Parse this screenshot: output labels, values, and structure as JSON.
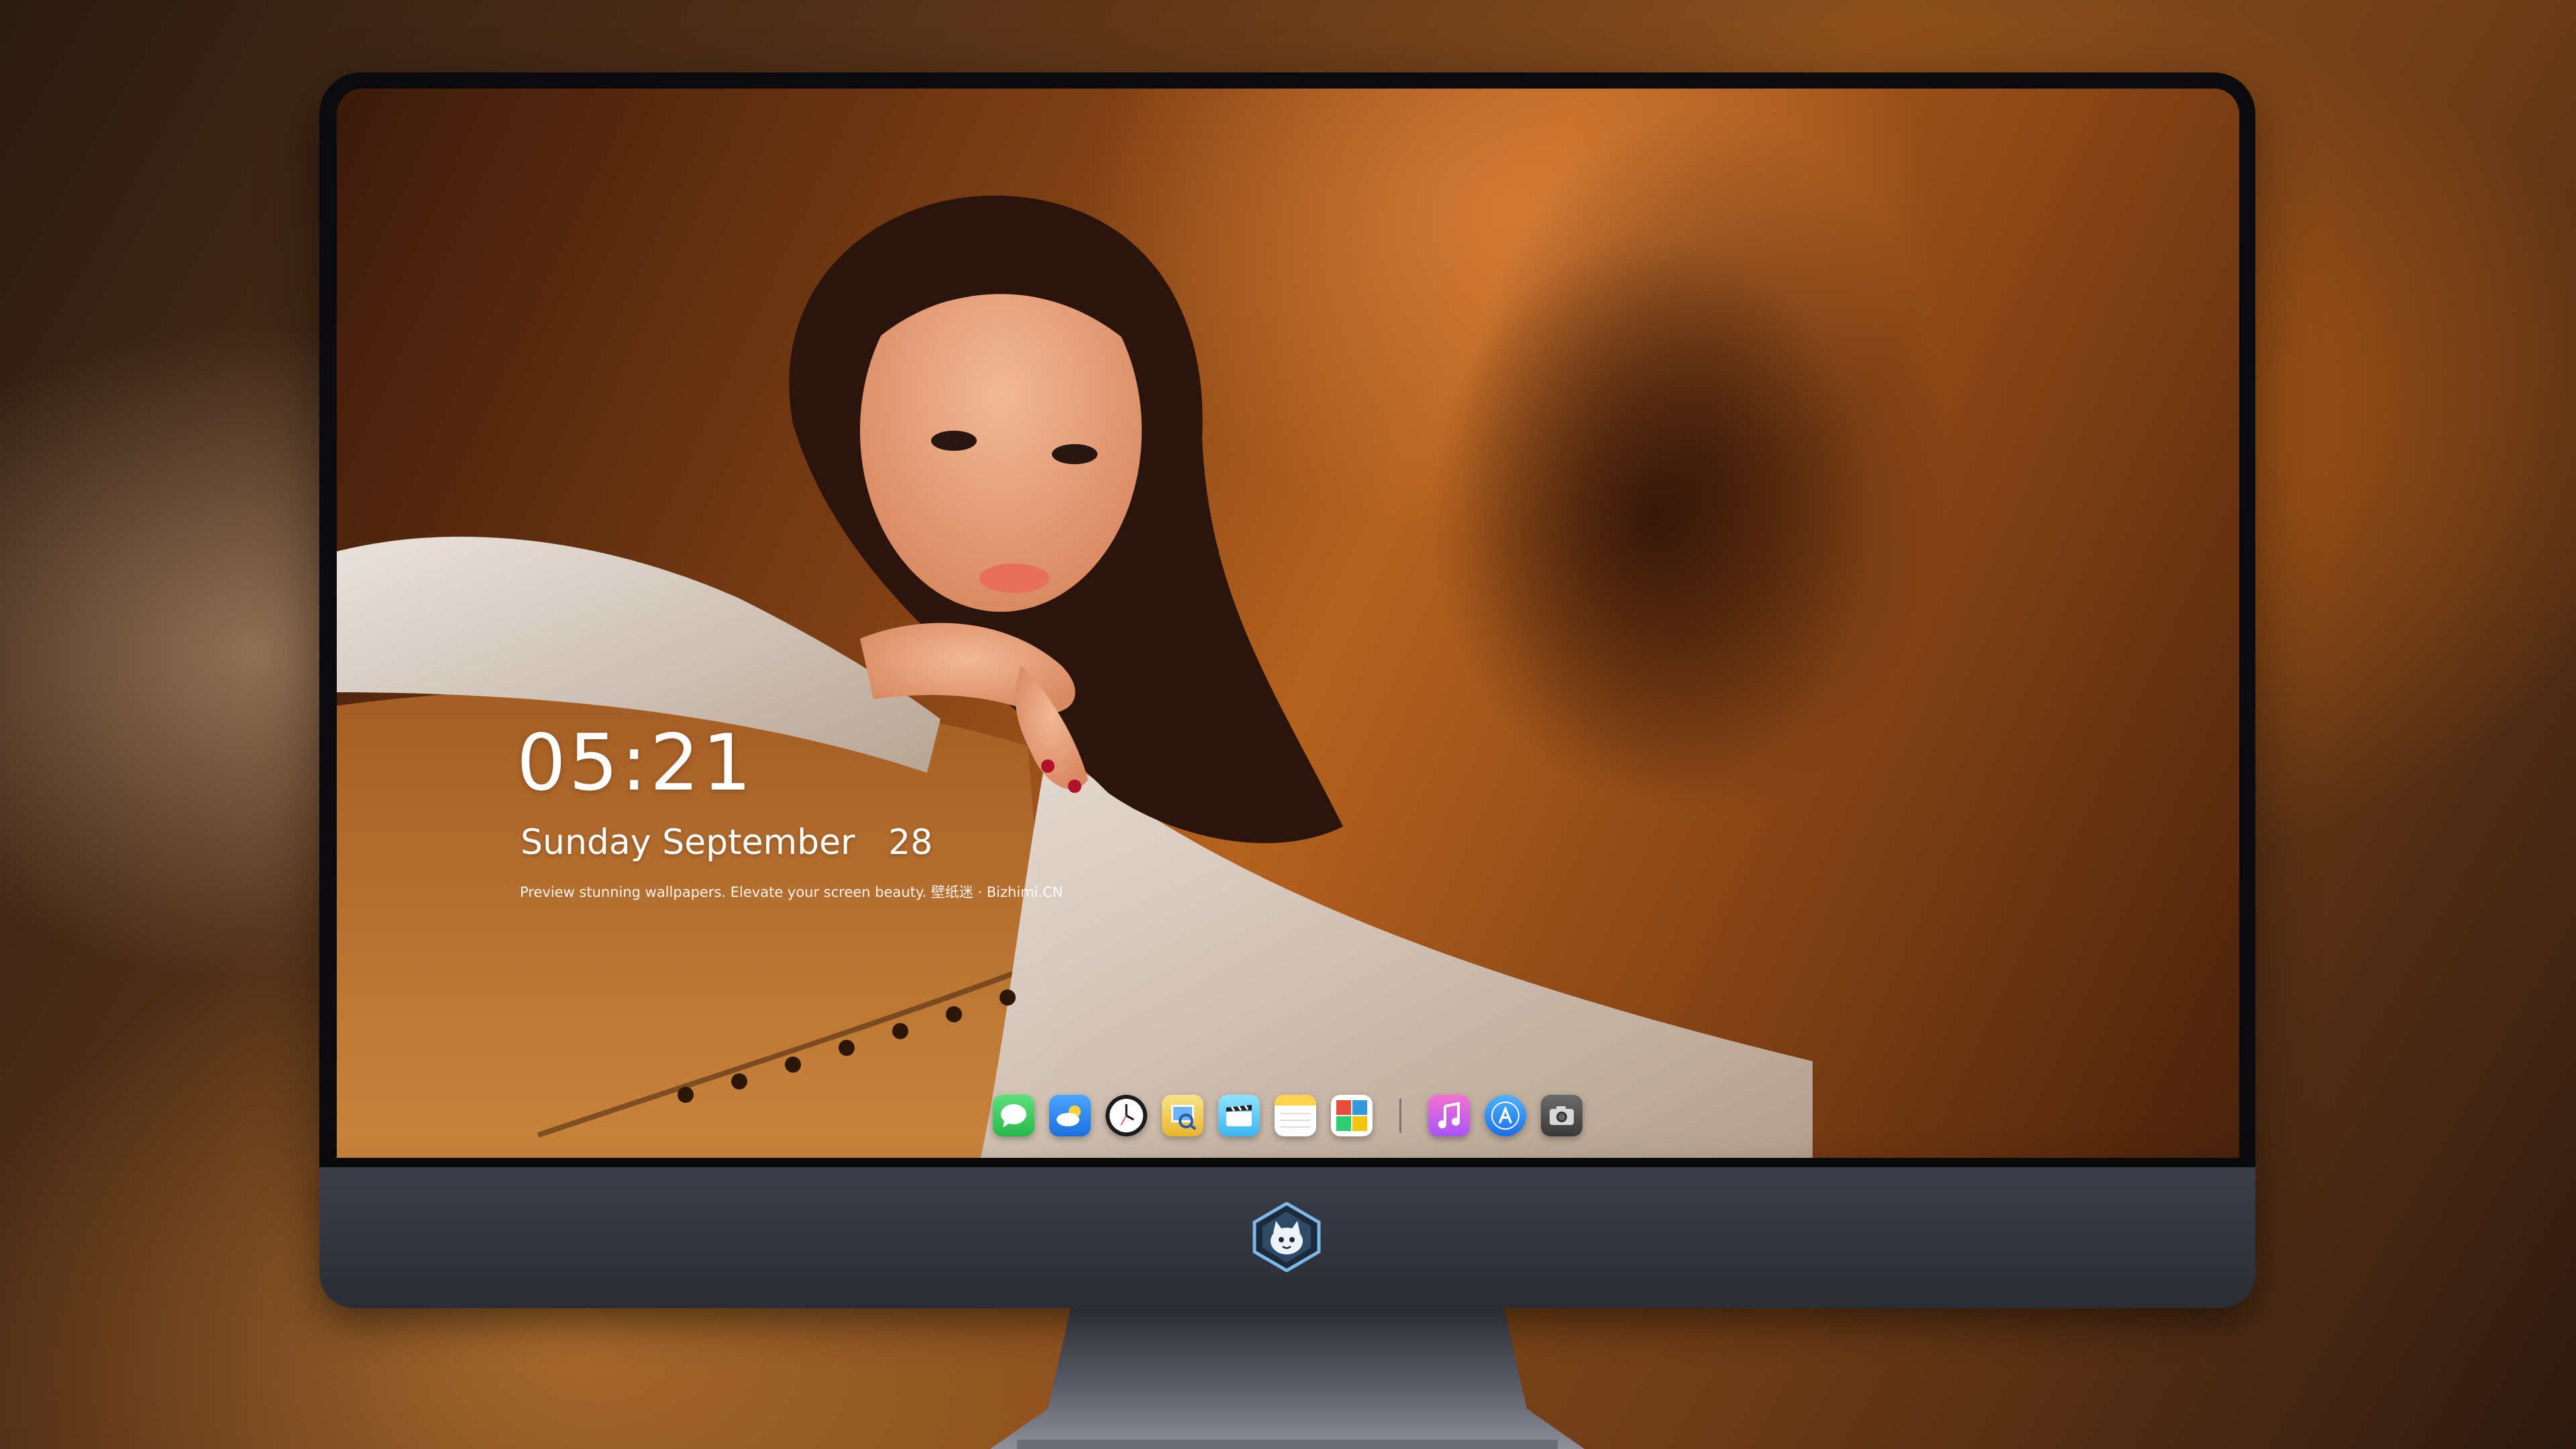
{
  "lockscreen": {
    "time": "05:21",
    "date": "Sunday September   28",
    "caption": "Preview stunning wallpapers. Elevate your screen beauty. 壁纸迷 · Bizhimi.CN"
  },
  "dock": {
    "apps": [
      {
        "icon": "messages-icon",
        "color": "#34c759"
      },
      {
        "icon": "weather-icon",
        "color": "#2f8cf0"
      },
      {
        "icon": "clock-icon",
        "color": "#1c1c1e"
      },
      {
        "icon": "preview-icon",
        "color": "#f2c94c"
      },
      {
        "icon": "clips-icon",
        "color": "#5ac8fa"
      },
      {
        "icon": "notes-icon",
        "color": "#fcd34d"
      },
      {
        "icon": "photo-booth-icon",
        "color": "#e74c3c"
      },
      {
        "icon": "itunes-icon",
        "color": "#d946ef"
      },
      {
        "icon": "app-store-icon",
        "color": "#1a8cff"
      },
      {
        "icon": "screenshot-icon",
        "color": "#4a4a4a"
      }
    ]
  },
  "device": {
    "chin_logo": "cat-mascot-logo-icon",
    "bezel_color": "#0b0b0d",
    "chin_color": "#34363f"
  }
}
